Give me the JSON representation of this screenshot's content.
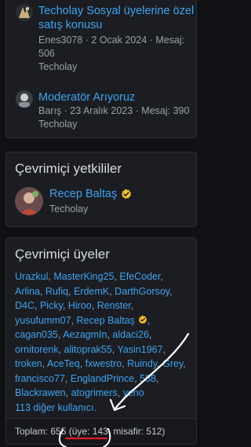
{
  "threads": [
    {
      "title": "Techolay Sosyal üyelerine özel satış konusu",
      "meta": "Enes3078 · 2 Ocak 2024 · Mesaj: 506",
      "forum": "Techolay",
      "avatar_icon": "user-avatar-icon"
    },
    {
      "title": "Moderatör Arıyoruz",
      "meta": "Barış · 23 Aralık 2023 · Mesaj: 390",
      "forum": "Techolay",
      "avatar_icon": "user-avatar-icon"
    }
  ],
  "staff": {
    "title": "Çevrimiçi yetkililer",
    "member": {
      "name": "Recep Baltaş",
      "role": "Techolay"
    }
  },
  "online": {
    "title": "Çevrimiçi üyeler",
    "users": [
      "Urazkul",
      "MasterKing25",
      "EfeCoder",
      "Arlina",
      "Rufiq",
      "ErdemK",
      "DarthGorsoy",
      "D4C",
      "Picky",
      "Hiroo",
      "Renster",
      "yusufumm07",
      "Recep Baltaş",
      "cagan035",
      "AezagmIn",
      "aldaci26",
      "ornitorenk",
      "alitoprak55",
      "Yasin1967",
      "troken",
      "AceTeq",
      "fxwestro",
      "Ruindy",
      "Grey",
      "francisco77",
      "EnglandPrince",
      "588",
      "Blackrawen",
      "atogrimers",
      "yeno"
    ],
    "more_text": "113 diğer kullanıcı.",
    "footer": "Toplam: 655 (üye: 143, misafir: 512)"
  },
  "colors": {
    "link": "#3fa3f0",
    "background": "#101114",
    "card": "#1b1d22",
    "annotation_red": "#e01b24",
    "annotation_white": "#ffffff"
  }
}
